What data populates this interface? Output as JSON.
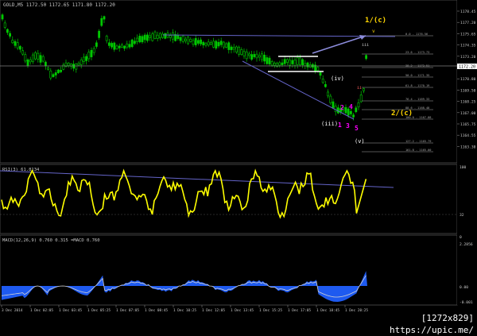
{
  "colors": {
    "background": "#000000",
    "bull_candle": "#00c800",
    "bear_candle": "#00c800",
    "rsi_line": "#ffff00",
    "macd_fill": "#1e5af0",
    "macd_signal": "#d2d2d2",
    "trendline": "#6464c8",
    "text": "#c8c8c8",
    "wave_white": "#ffffff",
    "wave_magenta": "#ff00ff",
    "wave_yellow": "#ffd700",
    "fib_gray": "#aaaaaa",
    "arrow": "#8c8cdc"
  },
  "main_panel": {
    "header": "GOLD,M5  1172.50 1172.65 1171.80 1172.20",
    "price_labels": [
      "1178.45",
      "1177.20",
      "1175.65",
      "1174.35",
      "1173.20",
      "1172.20",
      "1170.80",
      "1169.50",
      "1168.25",
      "1167.00",
      "1165.75",
      "1164.55",
      "1163.30"
    ],
    "current_price": "1172.20",
    "wave_labels": {
      "w1c": "1/(c)",
      "w2c": "2/(c)",
      "iii": "(iii)",
      "iv": "(iv)",
      "v": "(v)",
      "sub1": "1",
      "sub2": "2",
      "sub3": "3",
      "sub4": "4",
      "sub5": "5",
      "mini_i": "iii",
      "mini_ii": "ii",
      "mini_v": "v"
    },
    "fib_labels": [
      "0.0 - 1176.56",
      "23.6 - 1173.73",
      "38.2 - 1172.51",
      "50.0 - 1171.35",
      "61.8 - 1170.19",
      "76.4 - 1169.33",
      "88.6 - 1168.48",
      "100.0 - 1167.88",
      "127.2 - 1165.79",
      "161.8 - 1165.00"
    ]
  },
  "rsi_panel": {
    "header": "RSI(3) 61.8134",
    "labels": [
      "100",
      "32",
      "0"
    ]
  },
  "macd_panel": {
    "header": "MACD(12,26,9) 0.760  0.315  =MACD 0.760",
    "labels": [
      "2.2856",
      "0.00",
      "-0.001"
    ]
  },
  "time_axis": {
    "labels": [
      "3 Dec 2014",
      "1 Dec 02:05",
      "1 Dec 03:45",
      "1 Dec 05:25",
      "1 Dec 07:05",
      "1 Dec 08:45",
      "1 Dec 10:25",
      "1 Dec 12:05",
      "1 Dec 13:45",
      "1 Dec 15:25",
      "1 Dec 17:05",
      "1 Dec 18:45",
      "1 Dec 20:25"
    ]
  },
  "watermark": "[1272x829] https://upic.me/"
}
